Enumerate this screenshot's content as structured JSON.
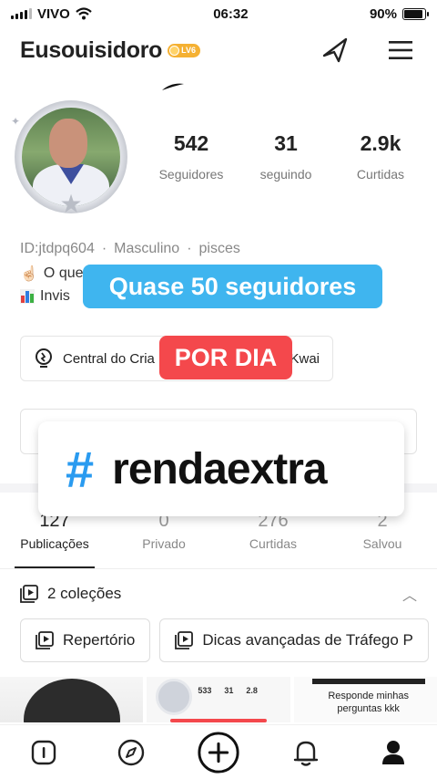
{
  "status_bar": {
    "carrier": "VIVO",
    "time": "06:32",
    "battery": "90%",
    "battery_level": 0.9
  },
  "header": {
    "username": "Eusouisidoro",
    "level": "LV6"
  },
  "stats": [
    {
      "value": "542",
      "label": "Seguidores"
    },
    {
      "value": "31",
      "label": "seguindo"
    },
    {
      "value": "2.9k",
      "label": "Curtidas"
    }
  ],
  "bio": {
    "id": "ID:jtdpq604",
    "gender": "Masculino",
    "sign": "pisces",
    "line1": "O que",
    "line2": "Invis"
  },
  "creator_button": {
    "label_left": "Central do Cria",
    "label_right": "Kwai"
  },
  "overlays": {
    "caption_blue": "Quase 50 seguidores",
    "caption_red": "POR DIA",
    "hashtag_symbol": "#",
    "hashtag_text": "rendaextra"
  },
  "tabs": [
    {
      "count": "127",
      "label": "Publicações"
    },
    {
      "count": "0",
      "label": "Privado"
    },
    {
      "count": "276",
      "label": "Curtidas"
    },
    {
      "count": "2",
      "label": "Salvou"
    }
  ],
  "collections": {
    "title": "2 coleções",
    "items": [
      "Repertório",
      "Dicas avançadas de Tráfego P"
    ]
  },
  "thumbnails": {
    "mini_stats": [
      "533",
      "31",
      "2.8"
    ],
    "text": "Responde minhas perguntas kkk"
  },
  "colors": {
    "blue": "#3fb5ef",
    "red": "#f4484c",
    "hashtag": "#2a9bf0",
    "badge": "#f5b133"
  }
}
